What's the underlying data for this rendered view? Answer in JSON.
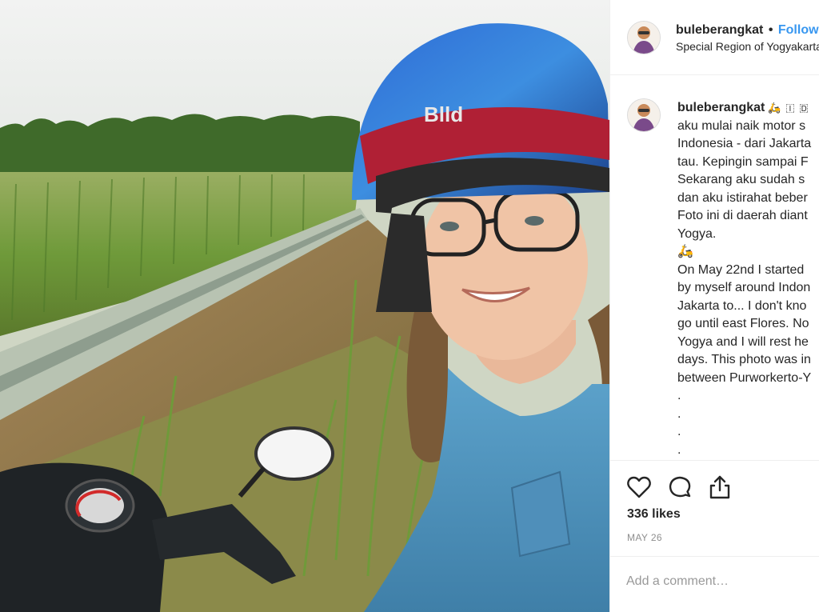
{
  "post": {
    "username": "buleberangkat",
    "separator": "•",
    "follow_label": "Follow",
    "location": "Special Region of Yogyakarta",
    "likes": "336 likes",
    "date": "MAY 26"
  },
  "caption": {
    "username": "buleberangkat",
    "emojis": "🛵 🇮 🇩",
    "lines": [
      "aku mulai naik motor s",
      "Indonesia - dari Jakarta",
      "tau. Kepingin sampai F",
      "Sekarang aku sudah s",
      "dan aku istirahat beber",
      "Foto ini di daerah diant",
      "Yogya.",
      "🛵",
      "On May 22nd I started",
      "by myself around Indon",
      "Jakarta to... I don't kno",
      "go until east Flores. No",
      "Yogya and I will rest he",
      "days. This photo was in",
      "between Purworkerto-Y",
      ".",
      ".",
      ".",
      "."
    ]
  },
  "comment": {
    "placeholder": "Add a comment…"
  },
  "icons": {
    "like": "heart-icon",
    "comment": "comment-bubble-icon",
    "share": "share-icon"
  },
  "colors": {
    "link_blue": "#3897f0",
    "border": "#efefef",
    "muted": "#8e8e8e"
  }
}
